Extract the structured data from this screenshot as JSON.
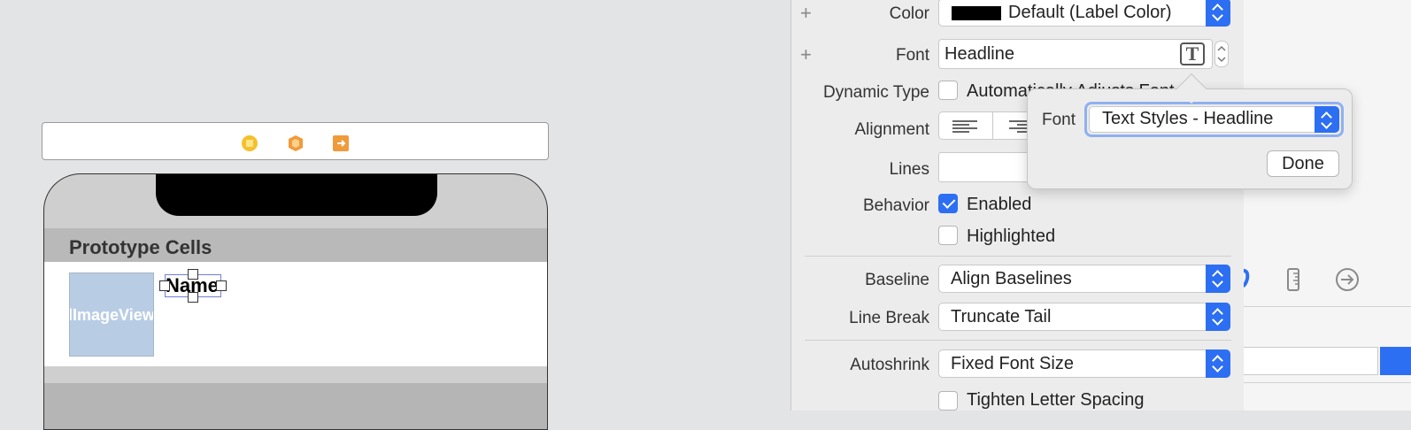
{
  "canvas": {
    "section_header": "Prototype Cells",
    "image_view_label": "lImageView",
    "name_label": "Name",
    "dock_icons": [
      "view-controller-icon",
      "first-responder-icon",
      "exit-icon"
    ]
  },
  "inspector": {
    "color": {
      "label": "Color",
      "value": "Default (Label Color)",
      "swatch": "#000000"
    },
    "font": {
      "label": "Font",
      "value": "Headline",
      "button_icon": "T"
    },
    "dynamic_type": {
      "label": "Dynamic Type",
      "checkbox_label": "Automatically Adjusts Font"
    },
    "alignment": {
      "label": "Alignment"
    },
    "lines": {
      "label": "Lines"
    },
    "behavior": {
      "label": "Behavior",
      "enabled": "Enabled",
      "highlighted": "Highlighted"
    },
    "baseline": {
      "label": "Baseline",
      "value": "Align Baselines"
    },
    "line_break": {
      "label": "Line Break",
      "value": "Truncate Tail"
    },
    "autoshrink": {
      "label": "Autoshrink",
      "value": "Fixed Font Size"
    },
    "tighten": {
      "checkbox_label": "Tighten Letter Spacing"
    }
  },
  "popover": {
    "font_label": "Font",
    "font_value": "Text Styles - Headline",
    "done": "Done"
  },
  "colors": {
    "accent": "#2d6ff2"
  }
}
